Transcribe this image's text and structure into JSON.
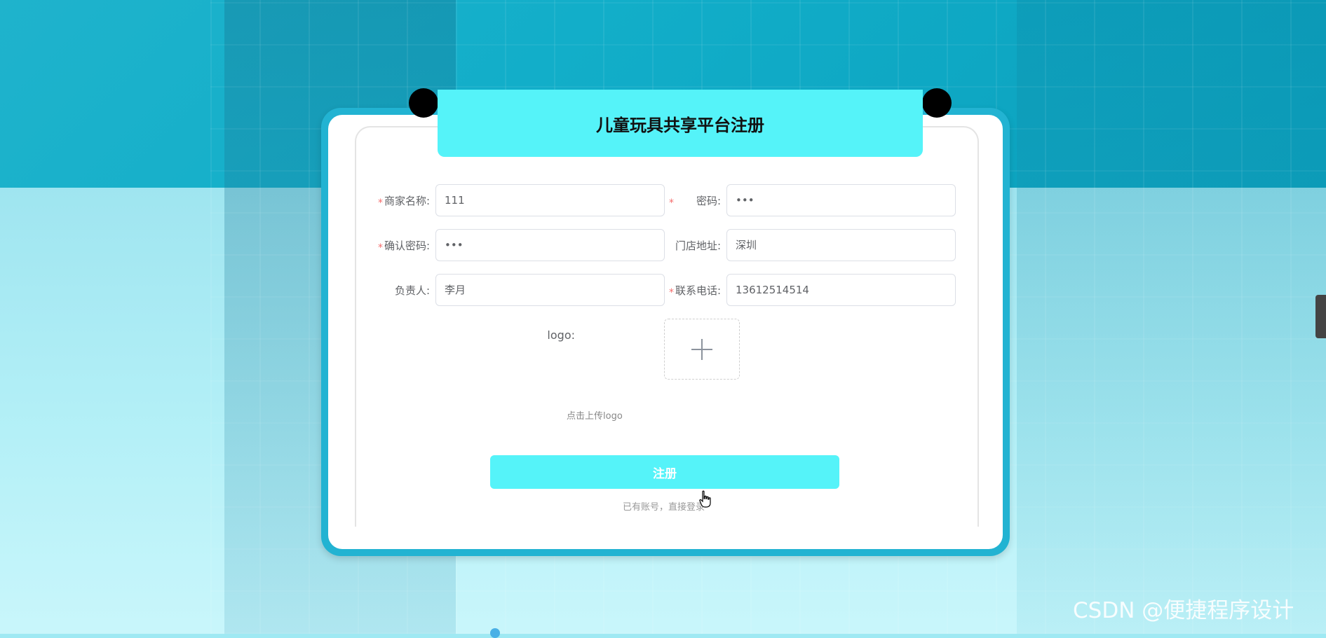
{
  "page": {
    "title": "儿童玩具共享平台注册"
  },
  "form": {
    "merchant_name": {
      "label": "商家名称:",
      "value": "111",
      "required": true
    },
    "password": {
      "label": "密码:",
      "value": "•••",
      "required": true
    },
    "confirm_password": {
      "label": "确认密码:",
      "value": "•••",
      "required": true
    },
    "store_address": {
      "label": "门店地址:",
      "value": "深圳",
      "required": false
    },
    "manager": {
      "label": "负责人:",
      "value": "李月",
      "required": false
    },
    "phone": {
      "label": "联系电话:",
      "value": "13612514514",
      "required": true
    },
    "logo": {
      "label": "logo:",
      "hint": "点击上传logo"
    },
    "required_mark": "*"
  },
  "actions": {
    "register_label": "注册",
    "login_link": "已有账号，直接登录"
  },
  "watermark": "CSDN @便捷程序设计",
  "colors": {
    "accent": "#55f3f9",
    "card_border": "#22b3d2",
    "required": "#f56c6c"
  },
  "icons": {
    "upload": "plus-icon",
    "cursor": "hand-pointer-icon"
  }
}
